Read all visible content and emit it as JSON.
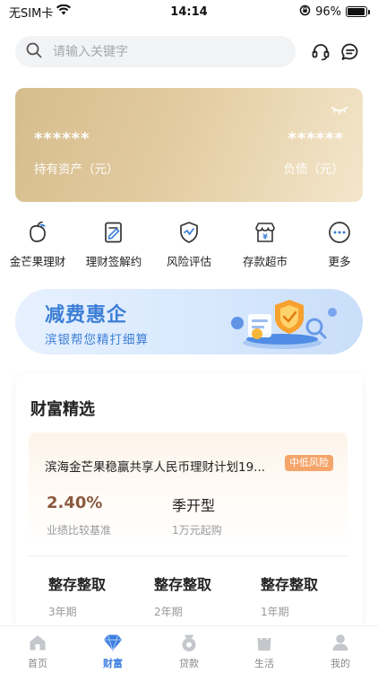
{
  "status_bar": {
    "carrier": "无SIM卡",
    "time": "14:14",
    "battery": "96%",
    "battery_level": 0.96
  },
  "search": {
    "placeholder": "请输入关键字",
    "icons": [
      "search-icon",
      "customer-service-icon",
      "message-icon"
    ]
  },
  "asset_card": {
    "holdings_value": "******",
    "holdings_label": "持有资产（元）",
    "debt_value": "******",
    "debt_label": "负债（元）",
    "visibility_icon": "eye-closed-icon"
  },
  "quick_menu": {
    "items": [
      {
        "label": "金芒果理财",
        "icon": "mango-icon"
      },
      {
        "label": "理财签解约",
        "icon": "sign-document-icon"
      },
      {
        "label": "风险评估",
        "icon": "shield-check-icon"
      },
      {
        "label": "存款超市",
        "icon": "shop-icon"
      },
      {
        "label": "更多",
        "icon": "more-icon"
      }
    ]
  },
  "banner": {
    "title": "减费惠企",
    "subtitle": "滨银帮您精打细算"
  },
  "wealth": {
    "title": "财富精选",
    "product": {
      "name": "滨海金芒果稳赢共享人民币理财计划19...",
      "risk": "中低风险",
      "rate": "2.40%",
      "rate_label": "业绩比较基准",
      "type": "季开型",
      "min_label": "1万元起购"
    },
    "deposits": [
      {
        "name": "整存整取",
        "term": "3年期"
      },
      {
        "name": "整存整取",
        "term": "2年期"
      },
      {
        "name": "整存整取",
        "term": "1年期"
      }
    ]
  },
  "tab_bar": {
    "tabs": [
      {
        "label": "首页",
        "icon": "home-icon",
        "active": false
      },
      {
        "label": "财富",
        "icon": "diamond-icon",
        "active": true
      },
      {
        "label": "贷款",
        "icon": "loan-icon",
        "active": false
      },
      {
        "label": "生活",
        "icon": "bag-icon",
        "active": false
      },
      {
        "label": "我的",
        "icon": "user-icon",
        "active": false
      }
    ]
  },
  "colors": {
    "accent": "#3e7fe0",
    "card_gold": "#e2cba0",
    "risk_badge": "#f5a46a",
    "rate_brown": "#8a5a3e"
  }
}
